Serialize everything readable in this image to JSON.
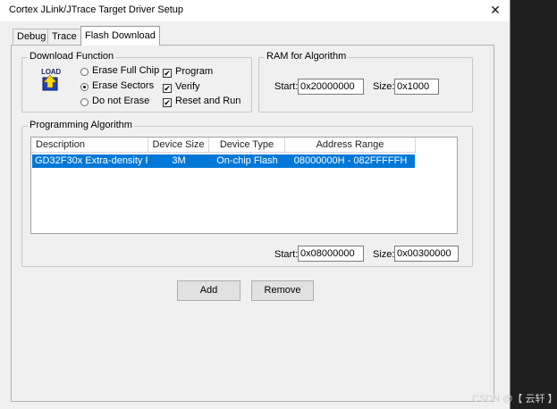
{
  "window": {
    "title": "Cortex JLink/JTrace Target Driver Setup",
    "close_glyph": "✕"
  },
  "tabs": [
    {
      "label": "Debug"
    },
    {
      "label": "Trace"
    },
    {
      "label": "Flash Download",
      "active": true
    }
  ],
  "download_function": {
    "group_label": "Download Function",
    "load_icon_text": "LOAD",
    "radios": [
      {
        "label": "Erase Full Chip",
        "selected": false
      },
      {
        "label": "Erase Sectors",
        "selected": true
      },
      {
        "label": "Do not Erase",
        "selected": false
      }
    ],
    "checkboxes": [
      {
        "label": "Program",
        "checked": true
      },
      {
        "label": "Verify",
        "checked": true
      },
      {
        "label": "Reset and Run",
        "checked": true
      }
    ]
  },
  "ram": {
    "group_label": "RAM for Algorithm",
    "start_label": "Start:",
    "start_value": "0x20000000",
    "size_label": "Size:",
    "size_value": "0x1000"
  },
  "programming": {
    "group_label": "Programming Algorithm",
    "columns": [
      "Description",
      "Device Size",
      "Device Type",
      "Address Range"
    ],
    "rows": [
      {
        "description": "GD32F30x Extra-density F...",
        "size": "3M",
        "type": "On-chip Flash",
        "range": "08000000H - 082FFFFFH",
        "selected": true
      }
    ],
    "start_label": "Start:",
    "start_value": "0x08000000",
    "size_label": "Size:",
    "size_value": "0x00300000"
  },
  "buttons": {
    "add": "Add",
    "remove": "Remove"
  },
  "watermark": "CSDN @【 云轩 】",
  "colors": {
    "selection": "#0078d7",
    "dialog_bg": "#f0f0f0",
    "outer_bg": "#1f1f1f"
  }
}
